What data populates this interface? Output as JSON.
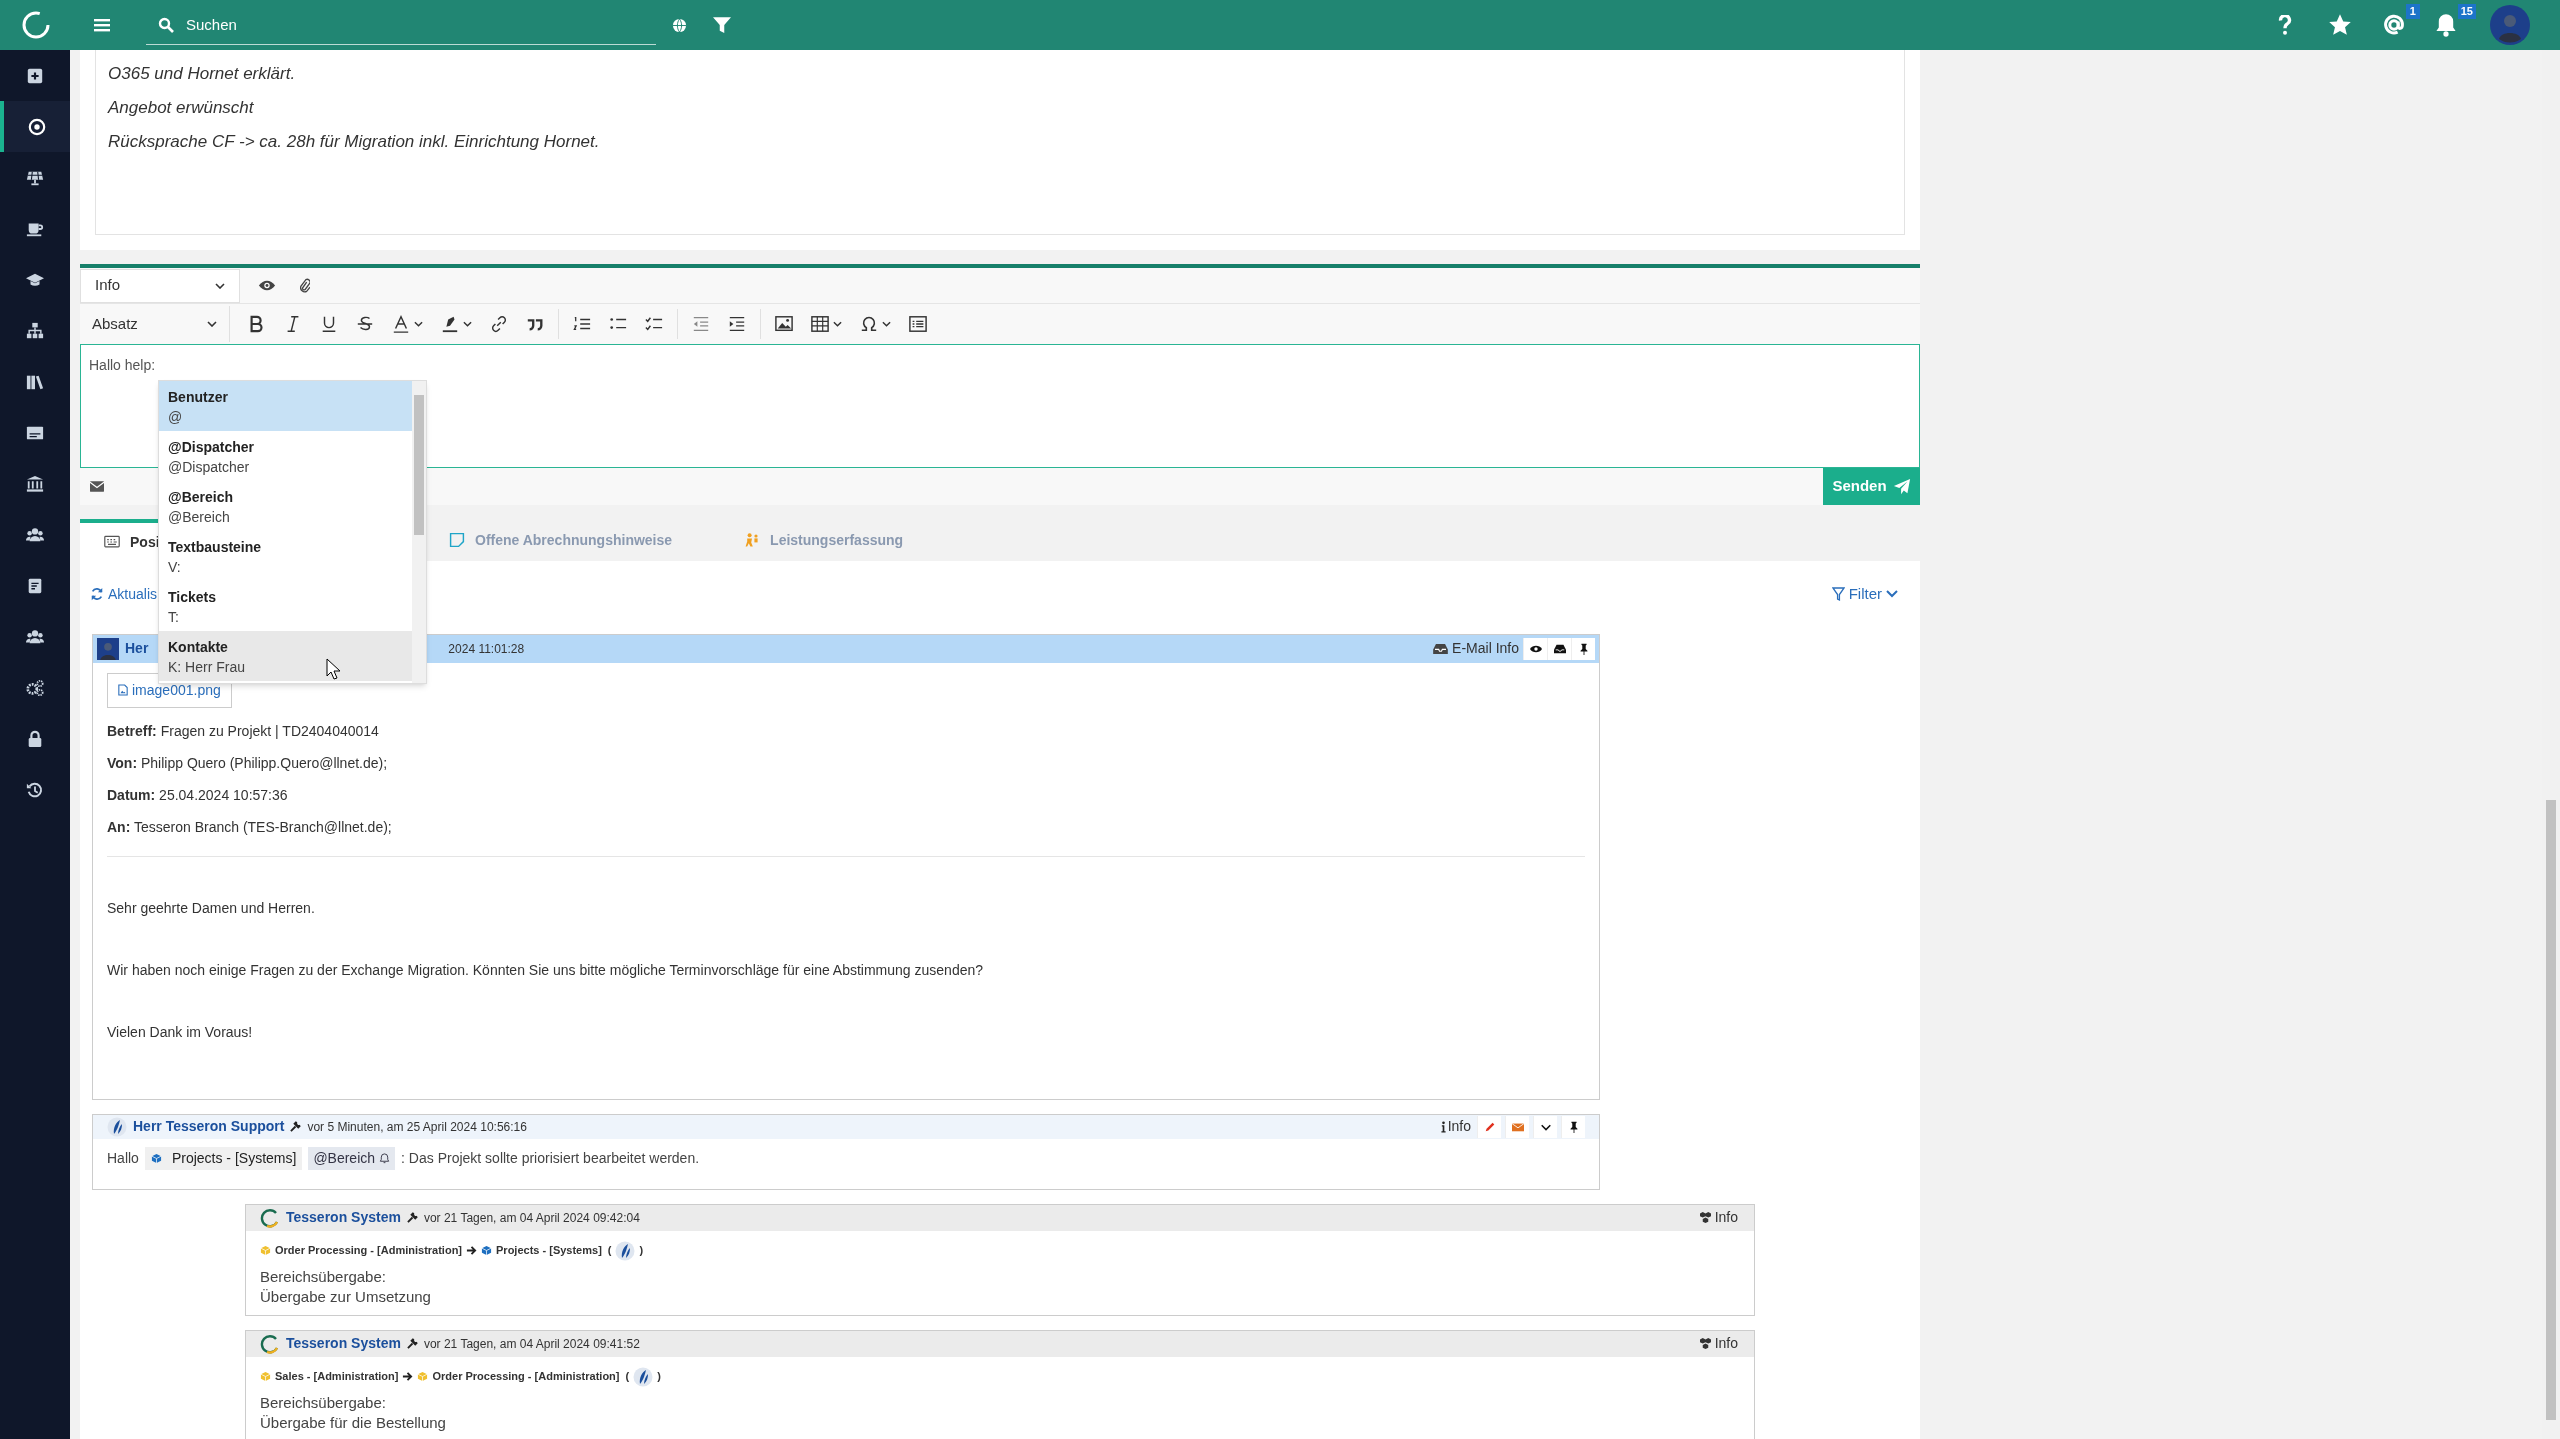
{
  "top_bar": {
    "search_placeholder": "Suchen",
    "mention_count": "1",
    "notification_count": "15"
  },
  "sidebar": {
    "items": [
      {
        "selected": false
      },
      {
        "selected": true
      },
      {
        "selected": false
      },
      {
        "selected": false
      },
      {
        "selected": false
      },
      {
        "selected": false
      },
      {
        "selected": false
      },
      {
        "selected": false
      },
      {
        "selected": false
      },
      {
        "selected": false
      },
      {
        "selected": false
      },
      {
        "selected": false
      },
      {
        "selected": false
      },
      {
        "selected": false
      },
      {
        "selected": false
      }
    ]
  },
  "note_lines": [
    "O365 und Hornet erklärt.",
    "Angebot erwünscht",
    "Rücksprache CF -> ca. 28h für Migration inkl. Einrichtung Hornet."
  ],
  "editor": {
    "type_select": "Info",
    "format_select": "Absatz",
    "text": "Hallo help:",
    "send_button": "Senden"
  },
  "mention_dropdown": {
    "items": [
      {
        "title": "Benutzer",
        "subtitle": "@",
        "selected": true
      },
      {
        "title": "@Dispatcher",
        "subtitle": "@Dispatcher",
        "selected": false
      },
      {
        "title": "@Bereich",
        "subtitle": "@Bereich",
        "selected": false
      },
      {
        "title": "Textbausteine",
        "subtitle": "V:",
        "selected": false
      },
      {
        "title": "Tickets",
        "subtitle": "T:",
        "selected": false
      },
      {
        "title": "Kontakte",
        "subtitle": "K: Herr Frau",
        "selected": false
      }
    ]
  },
  "tabs": [
    {
      "label": "Posi",
      "selected": true
    },
    {
      "label": "Offene Abrechnungshinweise",
      "selected": false
    },
    {
      "label": "Leistungserfassung",
      "selected": false
    }
  ],
  "refresh_link": "Aktualis",
  "filter_button": "Filter",
  "email": {
    "author": "Her",
    "time": "2024 11:01:28",
    "info_label": "E-Mail Info",
    "attachment": "image001.png",
    "fields": [
      {
        "label": "Betreff:",
        "value": "Fragen zu Projekt | TD2404040014"
      },
      {
        "label": "Von:",
        "value": "Philipp Quero (Philipp.Quero@llnet.de);"
      },
      {
        "label": "Datum:",
        "value": "25.04.2024 10:57:36"
      },
      {
        "label": "An:",
        "value": "Tesseron Branch (TES-Branch@llnet.de);"
      }
    ],
    "paragraphs": [
      "Sehr geehrte Damen und Herren.",
      "Wir haben noch einige Fragen zu der Exchange Migration. Könnten Sie uns bitte mögliche Terminvorschläge für eine Abstimmung zusenden?",
      "Vielen Dank im Voraus!"
    ]
  },
  "comment": {
    "author": "Herr Tesseron Support",
    "time": "vor 5 Minuten, am 25 April 2024 10:56:16",
    "info_label": "Info",
    "greeting": "Hallo",
    "project_chip": "Projects - [Systems]",
    "mention_chip": "@Bereich",
    "text": ": Das Projekt sollte priorisiert bearbeitet werden."
  },
  "system_entries": [
    {
      "author": "Tesseron System",
      "time": "vor 21 Tagen, am 04 April 2024 09:42:04",
      "info_label": "Info",
      "from": {
        "label": "Order Processing - [Administration]",
        "color": "#f0c030"
      },
      "to": {
        "label": "Projects - [Systems]",
        "color": "#1e6fc0"
      },
      "open_paren": "(",
      "close_paren": ")",
      "lines": [
        "Bereichsübergabe:",
        "Übergabe zur Umsetzung"
      ]
    },
    {
      "author": "Tesseron System",
      "time": "vor 21 Tagen, am 04 April 2024 09:41:52",
      "info_label": "Info",
      "from": {
        "label": "Sales - [Administration]",
        "color": "#f0c030"
      },
      "to": {
        "label": "Order Processing - [Administration]",
        "color": "#f0c030"
      },
      "open_paren": "(",
      "close_paren": ")",
      "lines": [
        "Bereichsübergabe:",
        "Übergabe für die Bestellung"
      ]
    }
  ]
}
